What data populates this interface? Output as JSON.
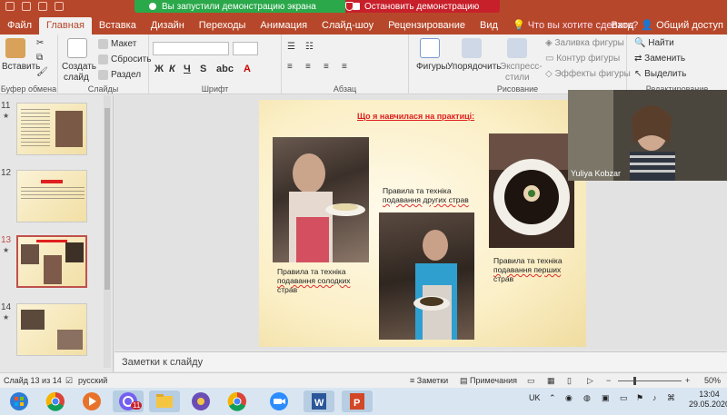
{
  "share_banner": {
    "active_text": "Вы запустили демонстрацию экрана",
    "stop_text": "Остановить демонстрацию"
  },
  "tabs": [
    "Файл",
    "Главная",
    "Вставка",
    "Дизайн",
    "Переходы",
    "Анимация",
    "Слайд-шоу",
    "Рецензирование",
    "Вид"
  ],
  "active_tab": "Главная",
  "tell_me": "Что вы хотите сделать?",
  "login": "Вход",
  "share": "Общий доступ",
  "ribbon": {
    "paste": "Вставить",
    "clipboard_label": "Буфер обмена",
    "new_slide": "Создать",
    "new_slide2": "слайд",
    "layout": "Макет",
    "reset": "Сбросить",
    "section": "Раздел",
    "slides_label": "Слайды",
    "font_label": "Шрифт",
    "paragraph_label": "Абзац",
    "shapes": "Фигуры",
    "arrange": "Упорядочить",
    "quick_styles": "Экспресс-",
    "quick_styles2": "стили",
    "shape_fill": "Заливка фигуры",
    "shape_outline": "Контур фигуры",
    "shape_effects": "Эффекты фигуры",
    "drawing_label": "Рисование",
    "find": "Найти",
    "replace": "Заменить",
    "select": "Выделить",
    "editing_label": "Редактирование"
  },
  "thumbs": [
    {
      "num": "11",
      "star": "★"
    },
    {
      "num": "12",
      "star": ""
    },
    {
      "num": "13",
      "star": "★"
    },
    {
      "num": "14",
      "star": "★"
    }
  ],
  "slide": {
    "title": "Що я навчилася на практиці:",
    "caption_left": [
      "Правила та техніка",
      "подавання солодких",
      "страв"
    ],
    "caption_mid": [
      "Правила та техніка",
      "подавання других страв"
    ],
    "caption_right": [
      "Правила та техніка",
      "подавання перших",
      "страв"
    ]
  },
  "webcam_name": "Yuliya Kobzar",
  "notes_placeholder": "Заметки к слайду",
  "status": {
    "slide_info": "Слайд 13 из 14",
    "language": "русский",
    "notes": "Заметки",
    "comments": "Примечания",
    "zoom": "50%"
  },
  "taskbar": {
    "lang": "UK",
    "time": "13:04",
    "date": "29.05.2020",
    "viber_badge": "11"
  },
  "colors": {
    "accent": "#b7472a",
    "green": "#2aa84a",
    "red": "#c8202b"
  }
}
